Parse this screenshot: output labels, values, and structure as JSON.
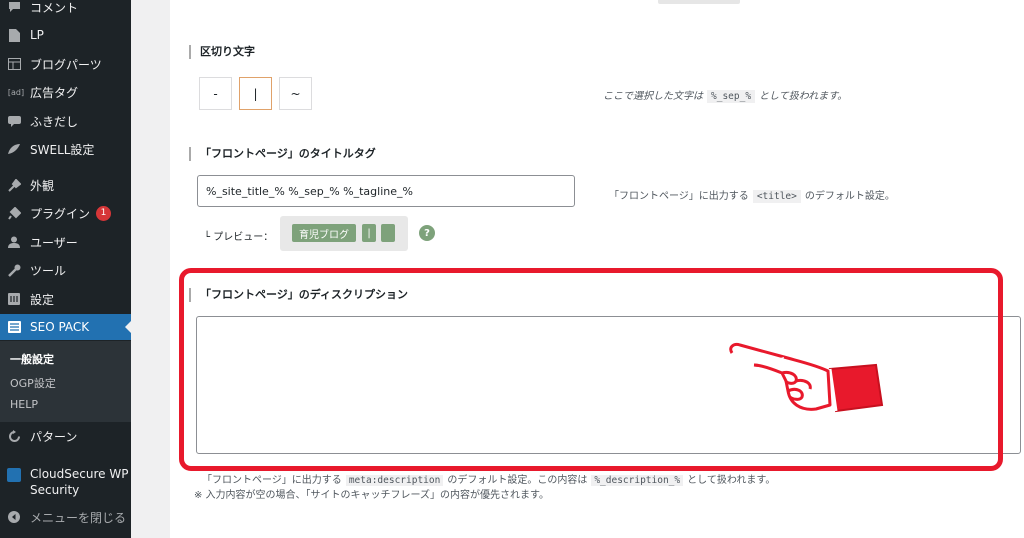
{
  "sidebar": {
    "items": [
      {
        "icon": "comment-icon",
        "label": "コメント"
      },
      {
        "icon": "page-icon",
        "label": "LP"
      },
      {
        "icon": "blog-parts-icon",
        "label": "ブログパーツ"
      },
      {
        "icon": "ad-icon",
        "icon_text": "[ad]",
        "label": "広告タグ"
      },
      {
        "icon": "balloon-icon",
        "label": "ふきだし"
      },
      {
        "icon": "swell-icon",
        "label": "SWELL設定"
      },
      {
        "icon": "appearance-icon",
        "label": "外観"
      },
      {
        "icon": "plugin-icon",
        "label": "プラグイン",
        "badge": "1"
      },
      {
        "icon": "user-icon",
        "label": "ユーザー"
      },
      {
        "icon": "tool-icon",
        "label": "ツール"
      },
      {
        "icon": "settings-icon",
        "label": "設定"
      }
    ],
    "active": {
      "icon": "seo-pack-icon",
      "label": "SEO PACK"
    },
    "submenu": [
      "一般設定",
      "OGP設定",
      "HELP"
    ],
    "pattern": {
      "label": "パターン"
    },
    "cloudsecure": {
      "label_line1": "CloudSecure WP",
      "label_line2": "Security"
    },
    "close": {
      "label": "メニューを閉じる"
    }
  },
  "separator": {
    "title": "区切り文字",
    "options": [
      "-",
      "|",
      "~"
    ],
    "selected": "|",
    "help_prefix": "ここで選択した文字は",
    "help_code": "%_sep_%",
    "help_suffix": "として扱われます。"
  },
  "front_title": {
    "title": "「フロントページ」のタイトルタグ",
    "value": "%_site_title_% %_sep_% %_tagline_%",
    "help_prefix": "「フロントページ」に出力する",
    "help_code": "<title>",
    "help_suffix": "のデフォルト設定。",
    "preview_label": "└ プレビュー：",
    "preview_chips": [
      "育児ブログ",
      "|",
      ""
    ],
    "help_icon": "?"
  },
  "front_desc": {
    "title": "「フロントページ」のディスクリプション",
    "value": "",
    "note1_prefix": "「フロントページ」に出力する",
    "note1_code1": "meta:description",
    "note1_mid": "のデフォルト設定。この内容は",
    "note1_code2": "%_description_%",
    "note1_suffix": "として扱われます。",
    "note2": "※ 入力内容が空の場合、「サイトのキャッチフレーズ」の内容が優先されます。"
  },
  "colors": {
    "sidebar_bg": "#1d2327",
    "active_bg": "#2271b1",
    "accent_green": "#7ea27b",
    "highlight_red": "#e8192c"
  }
}
